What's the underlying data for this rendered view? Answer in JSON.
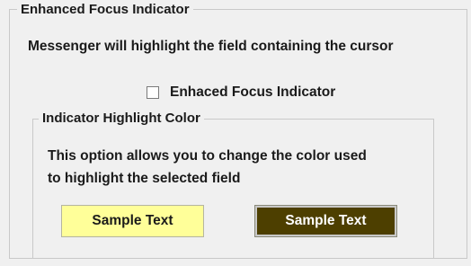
{
  "enhanced_focus": {
    "group_title": "Enhanced Focus Indicator",
    "description": "Messenger will highlight the field containing the cursor",
    "checkbox": {
      "label": "Enhaced Focus Indicator",
      "checked": false
    }
  },
  "highlight_color": {
    "group_title": "Indicator Highlight Color",
    "description_line1": "This option allows you to change the color used",
    "description_line2": "to highlight the selected field",
    "sample_light": {
      "label": "Sample Text",
      "background": "#ffff99",
      "text_color": "#1a1a1a"
    },
    "sample_dark": {
      "label": "Sample Text",
      "background": "#4d3f00",
      "text_color": "#ffffff"
    }
  }
}
